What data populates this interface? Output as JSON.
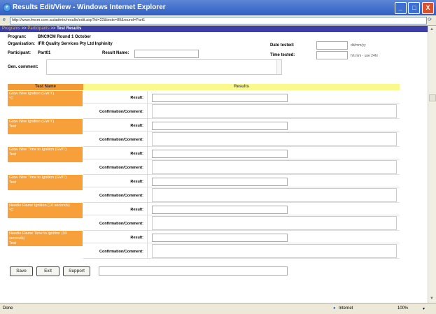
{
  "window": {
    "title": "Results Edit/View - Windows Internet Explorer",
    "minimize": "_",
    "maximize": "□",
    "close": "X"
  },
  "address": {
    "url": "http://www.fmcm.com.au/admin/results/edit.asp?id=22&tests=89&round=Part1"
  },
  "breadcrumb": {
    "link1": "Programs",
    "sep": " >> ",
    "link2": "Participants",
    "current": "Test Results"
  },
  "info": {
    "program_label": "Program:",
    "program_value": "BNC9CM Round 1 October",
    "organization_label": "Organisation:",
    "organization_value": "IFR Quality Services Pty Ltd  Inphinity",
    "participant_label": "Participant:",
    "participant_value": "Part01",
    "result_name_label": "Result Name:",
    "result_name_value": "",
    "general_comment_label": "Gen. comment:",
    "general_comment_value": "",
    "date_label": "Date tested:",
    "date_value": "",
    "date_format": "dd/mm/yy",
    "time_label": "Time tested:",
    "time_value": "",
    "time_format": "hh:mm - use 24hr"
  },
  "table": {
    "col_test_name": "Test Name",
    "col_results": "Results",
    "result_label": "Result:",
    "comment_label": "Confirmation/Comment:",
    "rows": [
      {
        "name": "Glow Wire Ignition (GWIT)",
        "unit": "°C",
        "result": "",
        "comment": ""
      },
      {
        "name": "Glow Wire Ignition (GWIT)",
        "unit": "Test",
        "result": "",
        "comment": ""
      },
      {
        "name": "Glow Wire Time to Ignition (GWT)",
        "unit": "Test",
        "result": "",
        "comment": ""
      },
      {
        "name": "Glow Wire Time to Ignition (GWT)",
        "unit": "Test",
        "result": "",
        "comment": ""
      },
      {
        "name": "Needle Flame Ignition (10 seconds)",
        "unit": "°C",
        "result": "",
        "comment": ""
      },
      {
        "name": "Needle Flame Time to Ignition (30 seconds)",
        "unit": "Test",
        "result": "",
        "comment": ""
      }
    ]
  },
  "buttons": {
    "save": "Save",
    "exit": "Exit",
    "support": "Support"
  },
  "status": {
    "left": "Done",
    "zone": "Internet",
    "zoom": "100%"
  }
}
